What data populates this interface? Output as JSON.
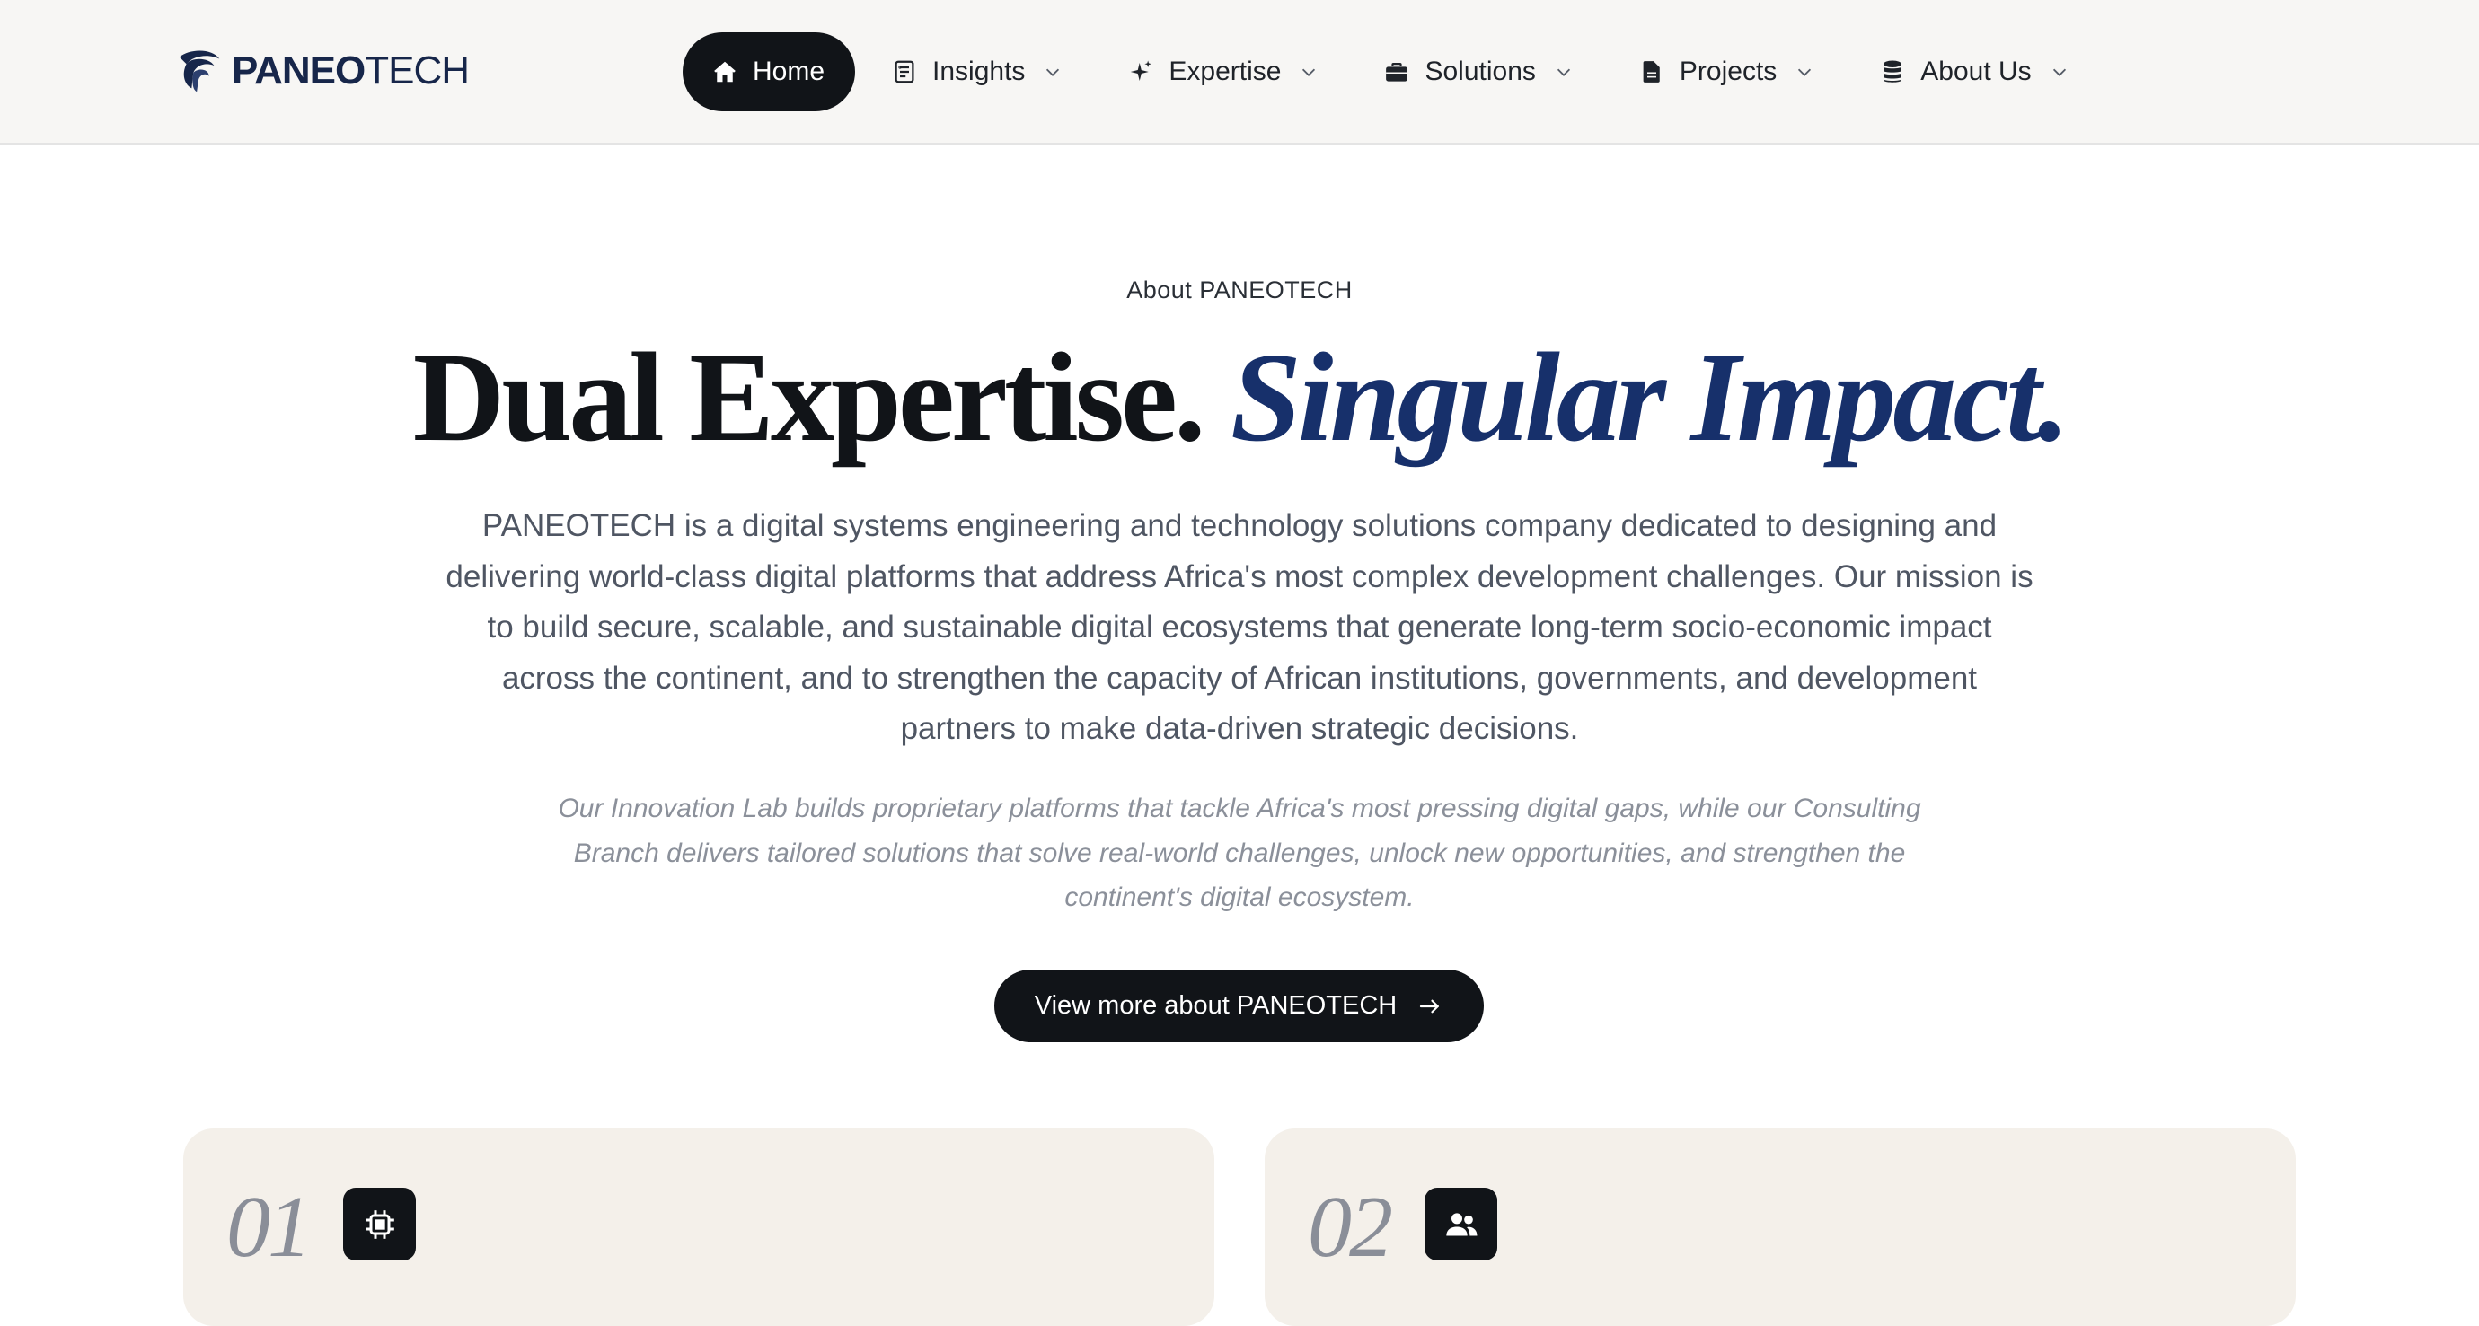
{
  "brand": {
    "name_bold": "PANEO",
    "name_light": "TECH"
  },
  "nav": {
    "items": [
      {
        "label": "Home",
        "icon": "home-icon",
        "active": true
      },
      {
        "label": "Insights",
        "icon": "document-list-icon",
        "active": false
      },
      {
        "label": "Expertise",
        "icon": "sparkles-icon",
        "active": false
      },
      {
        "label": "Solutions",
        "icon": "briefcase-icon",
        "active": false
      },
      {
        "label": "Projects",
        "icon": "file-icon",
        "active": false
      },
      {
        "label": "About Us",
        "icon": "database-icon",
        "active": false
      }
    ]
  },
  "hero": {
    "eyebrow": "About PANEOTECH",
    "headline_plain": "Dual Expertise.",
    "headline_accent": "Singular Impact.",
    "lead": "PANEOTECH is a digital systems engineering and technology solutions company dedicated to designing and delivering world-class digital platforms that address Africa's most complex development challenges. Our mission is to build secure, scalable, and sustainable digital ecosystems that generate long-term socio-economic impact across the continent, and to strengthen the capacity of African institutions, governments, and development partners to make data-driven strategic decisions.",
    "sub_lead": "Our Innovation Lab builds proprietary platforms that tackle Africa's most pressing digital gaps, while our Consulting Branch delivers tailored solutions that solve real-world challenges, unlock new opportunities, and strengthen the continent's digital ecosystem.",
    "cta_label": "View more about PANEOTECH"
  },
  "cards": [
    {
      "number": "01",
      "icon": "cpu-chip-icon"
    },
    {
      "number": "02",
      "icon": "users-icon"
    }
  ],
  "colors": {
    "ink": "#111418",
    "accent_navy": "#17306b",
    "header_bg": "#f7f6f4",
    "card_bg": "#f4f0ea",
    "body_text": "#4f5663",
    "muted_text": "#8b909a"
  }
}
